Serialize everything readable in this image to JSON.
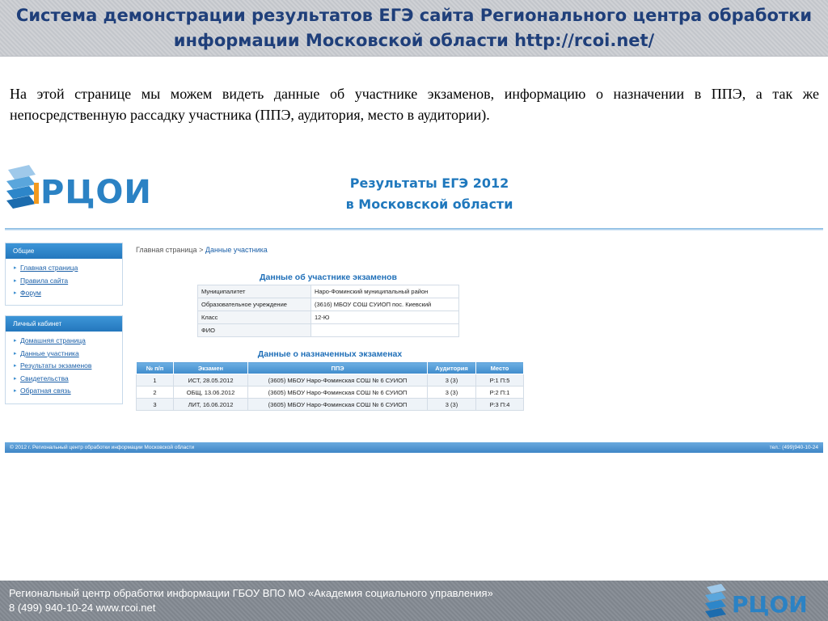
{
  "slide": {
    "title": "Система демонстрации результатов ЕГЭ сайта Регионального центра обработки информации Московской области http://rcoi.net/",
    "intro": "На этой странице мы можем видеть данные об участнике экзаменов, информацию о назначении в ППЭ, а так же непосредственную рассадку участника (ППЭ, аудитория, место в аудитории).",
    "footer_line1": "Региональный центр обработки информации ГБОУ ВПО МО «Академия социального управления»",
    "footer_line2": "8 (499) 940-10-24 www.rcoi.net"
  },
  "site": {
    "logo_text": "РЦОИ",
    "banner_line1": "Результаты ЕГЭ 2012",
    "banner_line2": "в Московской области",
    "sidebar": {
      "general": {
        "header": "Общие",
        "items": [
          "Главная страница",
          "Правила сайта",
          "Форум"
        ]
      },
      "cabinet": {
        "header": "Личный кабинет",
        "items": [
          "Домашняя страница",
          "Данные участника",
          "Результаты экзаменов",
          "Свидетельства",
          "Обратная связь"
        ]
      }
    },
    "breadcrumb": {
      "home": "Главная страница",
      "separator": ">",
      "current": "Данные участника"
    },
    "participant": {
      "title": "Данные об участнике экзаменов",
      "rows": [
        {
          "label": "Муниципалитет",
          "value": "Наро-Фоминский муниципальный район"
        },
        {
          "label": "Образовательное учреждение",
          "value": "(3616) МБОУ СОШ СУИОП пос. Киевский"
        },
        {
          "label": "Класс",
          "value": "12-Ю"
        },
        {
          "label": "ФИО",
          "value": ""
        }
      ]
    },
    "exams": {
      "title": "Данные о назначенных экзаменах",
      "headers": [
        "№ п/п",
        "Экзамен",
        "ППЭ",
        "Аудитория",
        "Место"
      ],
      "rows": [
        [
          "1",
          "ИСТ, 28.05.2012",
          "(3605) МБОУ Наро-Фоминская СОШ № 6 СУИОП",
          "3 (3)",
          "Р:1 П:5"
        ],
        [
          "2",
          "ОБЩ, 13.06.2012",
          "(3605) МБОУ Наро-Фоминская СОШ № 6 СУИОП",
          "3 (3)",
          "Р:2 П:1"
        ],
        [
          "3",
          "ЛИТ, 16.06.2012",
          "(3605) МБОУ Наро-Фоминская СОШ № 6 СУИОП",
          "3 (3)",
          "Р:3 П:4"
        ]
      ]
    },
    "footer": {
      "copyright": "© 2012 г. Региональный центр обработки информации Московской области",
      "phone": "тел.: (499)940-10-24"
    }
  },
  "colors": {
    "title_text": "#1f3f7a",
    "logo_blue": "#2b82c4",
    "logo_orange": "#f39a1e",
    "header_blue": "#3f8ccc"
  }
}
